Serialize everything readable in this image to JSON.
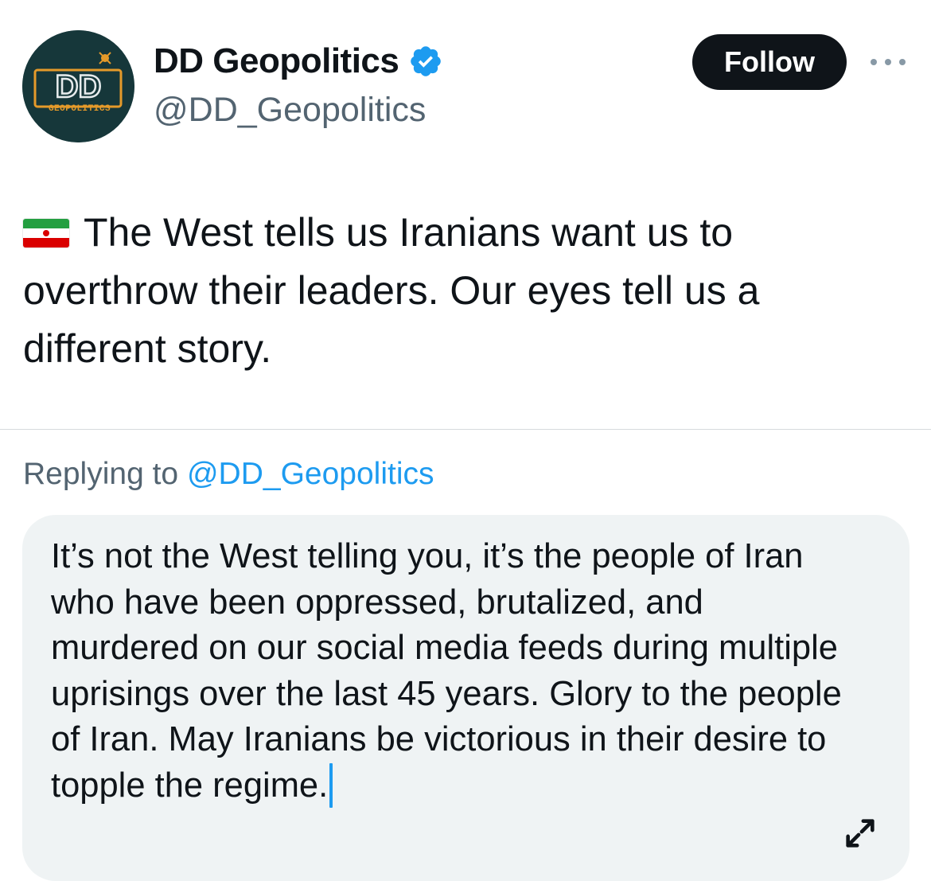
{
  "author": {
    "avatar_text": "DD",
    "avatar_subtext": "GEOPOLITICS",
    "display_name": "DD Geopolitics",
    "handle": "@DD_Geopolitics",
    "verified": true
  },
  "actions": {
    "follow_label": "Follow",
    "more_icon": "more-horizontal-icon"
  },
  "tweet": {
    "flag_icon": "iran-flag-icon",
    "text": "The West tells us Iranians want us to overthrow their leaders. Our eyes tell us a different story."
  },
  "reply": {
    "replying_to_prefix": "Replying to",
    "replying_to_handle": "@DD_Geopolitics",
    "draft_text": "It’s not the West telling you, it’s the people of Iran who have been oppressed, brutalized, and murdered on our social media feeds during multiple uprisings over the last 45 years. Glory to the people of Iran. May Iranians be victorious in their desire to topple the regime.",
    "expand_icon": "expand-icon"
  },
  "colors": {
    "accent": "#1d9bf0",
    "text_primary": "#0f1419",
    "text_secondary": "#536471",
    "compose_bg": "#eff3f4",
    "button_bg": "#0f1419",
    "avatar_bg": "#16373a",
    "avatar_logo": "#e59a2a"
  }
}
